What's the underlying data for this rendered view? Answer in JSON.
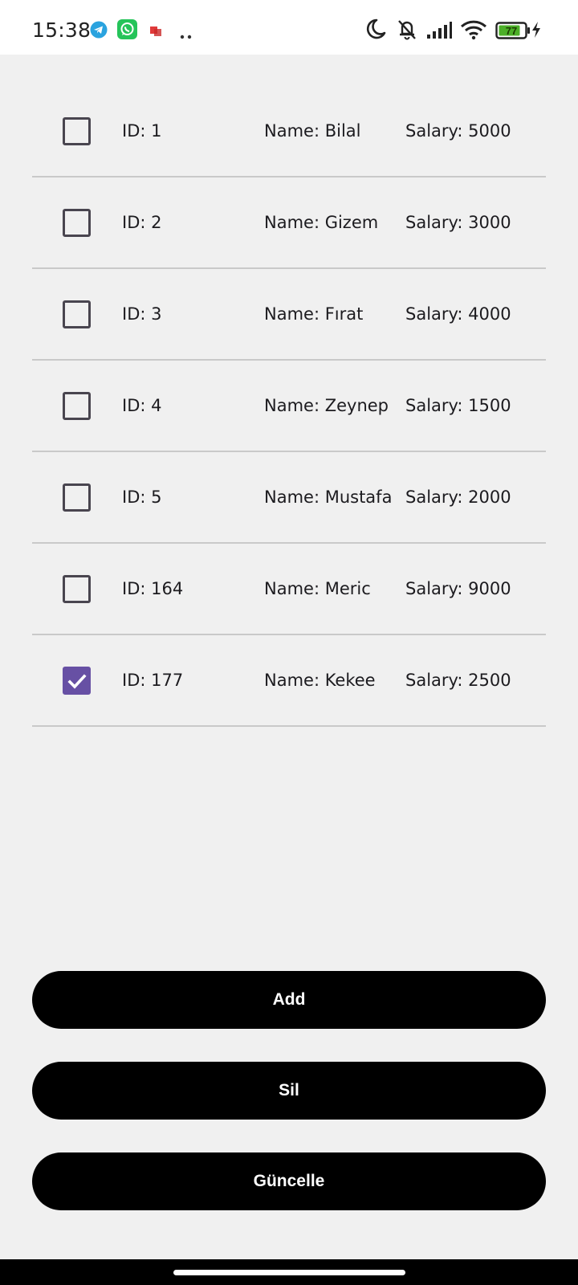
{
  "status_bar": {
    "time": "15:38",
    "left_icons": [
      "telegram-icon",
      "whatsapp-icon",
      "app-notification-icon",
      "more-notifications-icon"
    ],
    "right_icons": [
      "do-not-disturb-moon-icon",
      "bell-off-icon",
      "signal-icon",
      "wifi-icon",
      "battery-icon",
      "charging-icon"
    ],
    "battery_level": "77",
    "battery_color": "#4caf28"
  },
  "employees": [
    {
      "id": "ID: 1",
      "name": "Name: Bilal",
      "salary": "Salary: 5000",
      "checked": false
    },
    {
      "id": "ID: 2",
      "name": "Name: Gizem",
      "salary": "Salary: 3000",
      "checked": false
    },
    {
      "id": "ID: 3",
      "name": "Name: Fırat",
      "salary": "Salary: 4000",
      "checked": false
    },
    {
      "id": "ID: 4",
      "name": "Name: Zeynep",
      "salary": "Salary: 1500",
      "checked": false
    },
    {
      "id": "ID: 5",
      "name": "Name: Mustafa",
      "salary": "Salary: 2000",
      "checked": false
    },
    {
      "id": "ID: 164",
      "name": "Name: Meric",
      "salary": "Salary: 9000",
      "checked": false
    },
    {
      "id": "ID: 177",
      "name": "Name: Kekee",
      "salary": "Salary: 2500",
      "checked": true
    }
  ],
  "buttons": {
    "add": "Add",
    "delete": "Sil",
    "update": "Güncelle"
  },
  "colors": {
    "checkbox_checked": "#6750a4",
    "button_bg": "#000000",
    "background": "#f0f0f0"
  }
}
